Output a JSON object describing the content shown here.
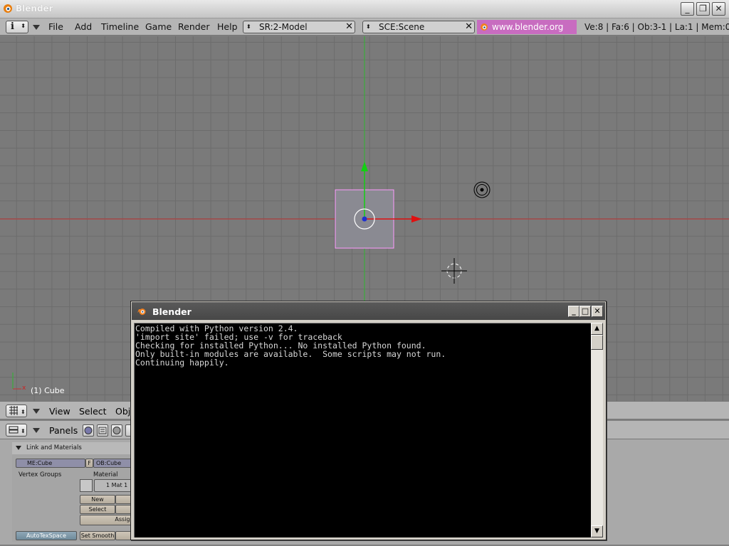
{
  "window": {
    "title": "Blender",
    "minimize_label": "_",
    "maximize_label": "❐",
    "close_label": "✕"
  },
  "header": {
    "menus": [
      "File",
      "Add",
      "Timeline",
      "Game",
      "Render",
      "Help"
    ],
    "screen_field": "SR:2-Model",
    "scene_field": "SCE:Scene",
    "website": "www.blender.org 243",
    "stats": "Ve:8 | Fa:6 | Ob:3-1 | La:1  | Mem:0"
  },
  "viewport": {
    "object_label": "(1) Cube",
    "axis_x": "x"
  },
  "view_header": {
    "menus": [
      "View",
      "Select",
      "Obj"
    ]
  },
  "buttons_header": {
    "panels_label": "Panels"
  },
  "panel": {
    "title": "Link and Materials",
    "mesh_field": "ME:Cube",
    "f_label": "F",
    "object_field": "OB:Cube",
    "vertex_groups_label": "Vertex Groups",
    "material_label": "Material",
    "material_slot": "1 Mat 1",
    "new_label": "New",
    "delete_label": "De",
    "select_label": "Select",
    "deselect_label": "Des",
    "assign_label": "Assign",
    "autotex_label": "AutoTexSpace",
    "set_smooth_label": "Set Smooth",
    "set_solid_label": "Set"
  },
  "console": {
    "title": "Blender",
    "lines": [
      "Compiled with Python version 2.4.",
      "'import site' failed; use -v for traceback",
      "Checking for installed Python... No installed Python found.",
      "Only built-in modules are available.  Some scripts may not run.",
      "Continuing happily."
    ],
    "scroll_up": "▲",
    "scroll_down": "▼"
  },
  "colors": {
    "website_bg": "#c86cc0",
    "console_bg": "#000000",
    "x_axis": "#e01010",
    "y_axis": "#10c010",
    "selection": "#ff99ff"
  }
}
